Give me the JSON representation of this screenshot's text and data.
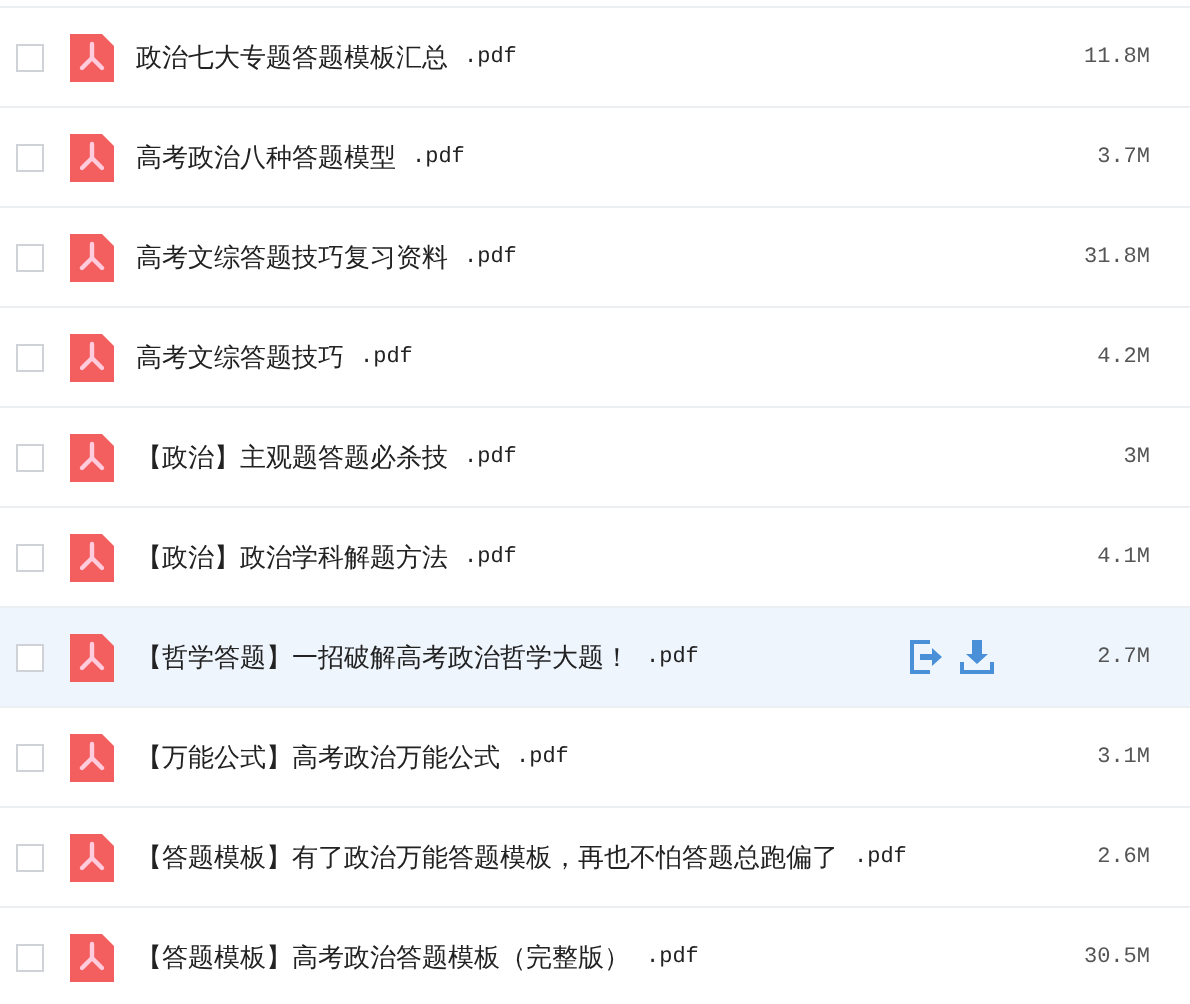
{
  "files": [
    {
      "name": "政治七大专题答题模板汇总",
      "ext": ".pdf",
      "size": "11.8M",
      "highlighted": false,
      "checked": false
    },
    {
      "name": "高考政治八种答题模型",
      "ext": ".pdf",
      "size": "3.7M",
      "highlighted": false,
      "checked": false
    },
    {
      "name": "高考文综答题技巧复习资料",
      "ext": ".pdf",
      "size": "31.8M",
      "highlighted": false,
      "checked": false
    },
    {
      "name": "高考文综答题技巧",
      "ext": ".pdf",
      "size": "4.2M",
      "highlighted": false,
      "checked": false
    },
    {
      "name": "【政治】主观题答题必杀技",
      "ext": ".pdf",
      "size": "3M",
      "highlighted": false,
      "checked": false
    },
    {
      "name": "【政治】政治学科解题方法",
      "ext": ".pdf",
      "size": "4.1M",
      "highlighted": false,
      "checked": false
    },
    {
      "name": "【哲学答题】一招破解高考政治哲学大题！",
      "ext": ".pdf",
      "size": "2.7M",
      "highlighted": true,
      "checked": false
    },
    {
      "name": "【万能公式】高考政治万能公式",
      "ext": ".pdf",
      "size": "3.1M",
      "highlighted": false,
      "checked": false
    },
    {
      "name": "【答题模板】有了政治万能答题模板，再也不怕答题总跑偏了",
      "ext": ".pdf",
      "size": "2.6M",
      "highlighted": false,
      "checked": false
    },
    {
      "name": "【答题模板】高考政治答题模板（完整版）",
      "ext": ".pdf",
      "size": "30.5M",
      "highlighted": false,
      "checked": false
    }
  ]
}
